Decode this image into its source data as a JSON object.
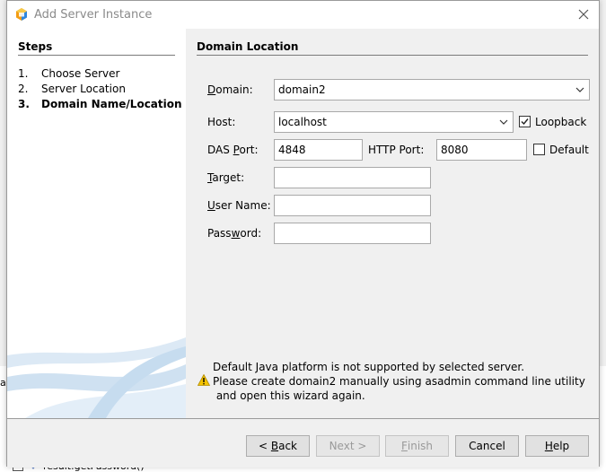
{
  "window": {
    "title": "Add Server Instance"
  },
  "steps": {
    "heading": "Steps",
    "items": [
      {
        "num": "1.",
        "label": "Choose Server",
        "current": false
      },
      {
        "num": "2.",
        "label": "Server Location",
        "current": false
      },
      {
        "num": "3.",
        "label": "Domain Name/Location",
        "current": true
      }
    ]
  },
  "form": {
    "heading": "Domain Location",
    "domain": {
      "label_pre": "",
      "mnemonic": "D",
      "label_post": "omain:",
      "value": "domain2"
    },
    "host": {
      "label": "Host:",
      "value": "localhost"
    },
    "loopback": {
      "label": "Loopback",
      "checked": true
    },
    "das_port": {
      "label_pre": "DAS ",
      "mnemonic": "P",
      "label_post": "ort:",
      "value": "4848"
    },
    "http_port": {
      "label": "HTTP Port:",
      "value": "8080"
    },
    "default": {
      "label": "Default",
      "checked": false
    },
    "target": {
      "label_pre": "",
      "mnemonic": "T",
      "label_post": "arget:",
      "value": ""
    },
    "user_name": {
      "label_pre": "",
      "mnemonic": "U",
      "label_post": "ser Name:",
      "value": ""
    },
    "password": {
      "label_pre": "Pass",
      "mnemonic": "w",
      "label_post": "ord:",
      "value": ""
    }
  },
  "warning": {
    "lines": [
      "Default Java platform is not supported by selected server.",
      "Please create domain2 manually using asadmin command line utility",
      " and open this wizard again."
    ]
  },
  "buttons": {
    "back": {
      "pre": "< ",
      "mnemonic": "B",
      "post": "ack"
    },
    "next": {
      "label": "Next >"
    },
    "finish": {
      "mnemonic": "F",
      "post": "inish"
    },
    "cancel": {
      "label": "Cancel"
    },
    "help": {
      "mnemonic": "H",
      "post": "elp"
    }
  },
  "background": {
    "edge_text": "a",
    "bottom_item": "result.getPassword()"
  },
  "colors": {
    "accent_icon_orange": "#f39c12",
    "accent_icon_blue": "#2e86de",
    "warning_yellow": "#f5c400"
  }
}
